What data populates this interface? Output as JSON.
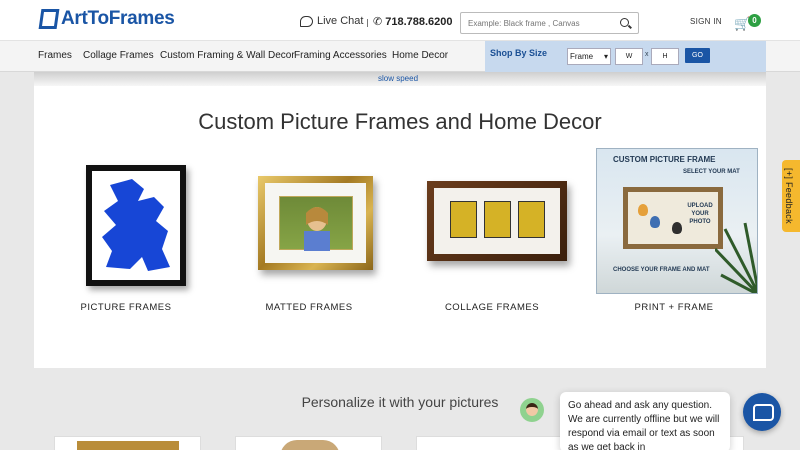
{
  "header": {
    "logo_text": "ArtToFrames",
    "live_chat": "Live Chat",
    "phone": "718.788.6200",
    "search_placeholder": "Example: Black frame , Canvas",
    "sign_in": "SIGN IN",
    "cart_count": "0"
  },
  "nav": {
    "items": [
      "Frames",
      "Collage Frames",
      "Custom Framing & Wall Decor",
      "Framing Accessories",
      "Home Decor"
    ]
  },
  "shop_by_size": {
    "title": "Shop By Size",
    "select_value": "Frame",
    "width_label": "W",
    "x_label": "x",
    "height_label": "H",
    "go_label": "GO"
  },
  "notice": "slow speed",
  "main": {
    "title": "Custom Picture Frames and Home Decor",
    "categories": [
      "PICTURE FRAMES",
      "MATTED FRAMES",
      "COLLAGE FRAMES",
      "PRINT + FRAME"
    ],
    "promo": {
      "title": "CUSTOM PICTURE FRAME",
      "select_mat": "SELECT YOUR MAT",
      "upload": "UPLOAD YOUR PHOTO",
      "choose": "CHOOSE YOUR FRAME AND MAT"
    }
  },
  "lower": {
    "title": "Personalize it with your pictures"
  },
  "chat": {
    "message": "Go ahead and ask any question. We are currently offline but we will respond via email or text as soon as we get back in"
  },
  "feedback_label": "[+] Feedback",
  "colors": {
    "brand_blue": "#1a55a5",
    "cart_badge": "#2ea043",
    "feedback": "#f5b82e",
    "shop_by_size_bg": "#c7d9ee"
  }
}
